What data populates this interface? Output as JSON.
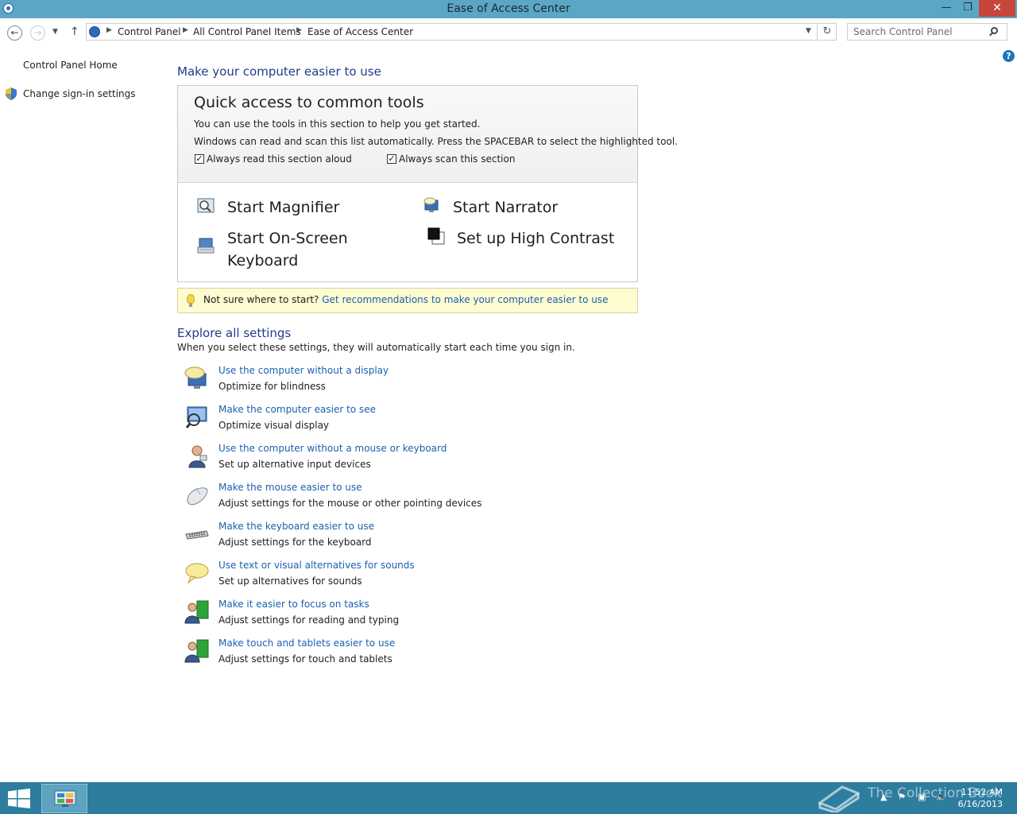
{
  "window": {
    "title": "Ease of Access Center",
    "minimize_glyph": "—",
    "maximize_glyph": "❐",
    "close_glyph": "✕"
  },
  "address_bar": {
    "crumbs": [
      "Control Panel",
      "All Control Panel Items",
      "Ease of Access Center"
    ],
    "back_glyph": "←",
    "forward_glyph": "→",
    "up_glyph": "↑",
    "refresh_glyph": "↻",
    "search_placeholder": "Search Control Panel"
  },
  "sidebar": {
    "home": "Control Panel Home",
    "sign_in": "Change sign-in settings"
  },
  "main": {
    "heading": "Make your computer easier to use",
    "quick_access": {
      "title": "Quick access to common tools",
      "line1": "You can use the tools in this section to help you get started.",
      "line2": "Windows can read and scan this list automatically.  Press the SPACEBAR to select the highlighted tool.",
      "read_aloud": {
        "label": "Always read this section aloud",
        "checked": true
      },
      "scan": {
        "label": "Always scan this section",
        "checked": true
      },
      "tools": {
        "magnifier": "Start Magnifier",
        "narrator": "Start Narrator",
        "keyboard_line1": "Start On-Screen",
        "keyboard_line2": "Keyboard",
        "contrast": "Set up High Contrast"
      }
    },
    "tip": {
      "prefix": "Not sure where to start?",
      "link": "Get recommendations to make your computer easier to use"
    },
    "explore": {
      "heading": "Explore all settings",
      "subtitle": "When you select these settings, they will automatically start each time you sign in.",
      "items": [
        {
          "link": "Use the computer without a display",
          "desc": "Optimize for blindness",
          "icon": "display-bubble-icon"
        },
        {
          "link": "Make the computer easier to see",
          "desc": "Optimize visual display",
          "icon": "monitor-icon"
        },
        {
          "link": "Use the computer without a mouse or keyboard",
          "desc": "Set up alternative input devices",
          "icon": "person-icon"
        },
        {
          "link": "Make the mouse easier to use",
          "desc": "Adjust settings for the mouse or other pointing devices",
          "icon": "mouse-icon"
        },
        {
          "link": "Make the keyboard easier to use",
          "desc": "Adjust settings for the keyboard",
          "icon": "keyboard-icon"
        },
        {
          "link": "Use text or visual alternatives for sounds",
          "desc": "Set up alternatives for sounds",
          "icon": "speech-bubble-icon"
        },
        {
          "link": "Make it easier to focus on tasks",
          "desc": "Adjust settings for reading and typing",
          "icon": "users-icon"
        },
        {
          "link": "Make touch and tablets easier to use",
          "desc": "Adjust settings for touch and tablets",
          "icon": "users-icon"
        }
      ]
    }
  },
  "taskbar": {
    "watermark": "The Collection Book",
    "time": "11:52 AM",
    "date": "6/16/2013"
  },
  "colors": {
    "titlebar": "#5aa6c4",
    "taskbar": "#2d7d9e",
    "link": "#1a60b0",
    "heading": "#1e3d8a",
    "close_button": "#c7463c",
    "tip_background": "#fdfbd0"
  }
}
